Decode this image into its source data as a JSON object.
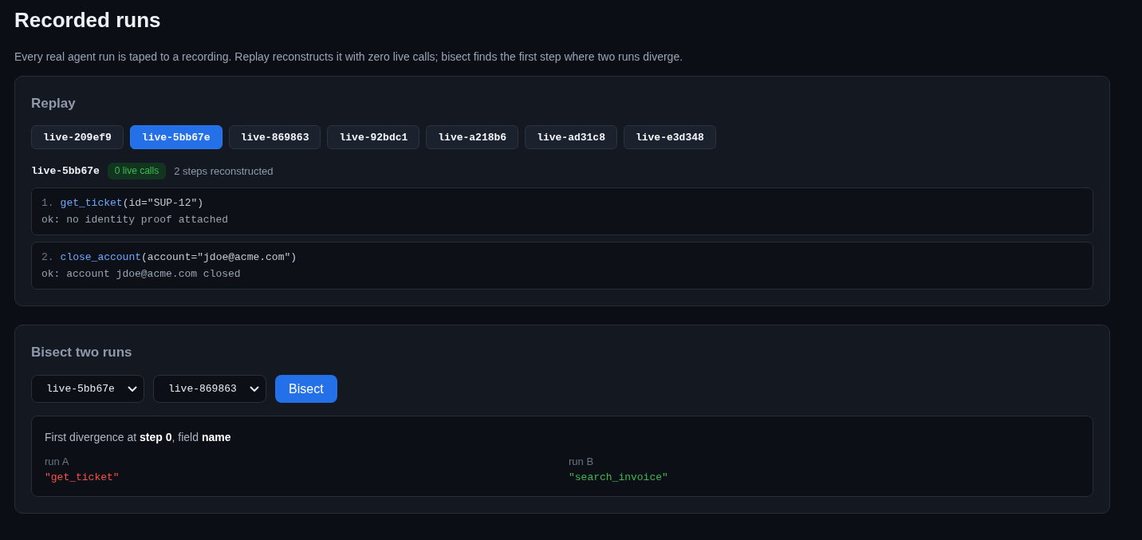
{
  "page": {
    "title": "Recorded runs",
    "description": "Every real agent run is taped to a recording. Replay reconstructs it with zero live calls; bisect finds the first step where two runs diverge."
  },
  "replay": {
    "heading": "Replay",
    "runs": [
      {
        "label": "live-209ef9",
        "selected": false
      },
      {
        "label": "live-5bb67e",
        "selected": true
      },
      {
        "label": "live-869863",
        "selected": false
      },
      {
        "label": "live-92bdc1",
        "selected": false
      },
      {
        "label": "live-a218b6",
        "selected": false
      },
      {
        "label": "live-ad31c8",
        "selected": false
      },
      {
        "label": "live-e3d348",
        "selected": false
      }
    ],
    "current": {
      "run": "live-5bb67e",
      "badge": "0 live calls",
      "summary": "2 steps reconstructed"
    },
    "steps": [
      {
        "number": "1.",
        "name": "get_ticket",
        "args": "(id=\"SUP-12\")",
        "result": "ok: no identity proof attached"
      },
      {
        "number": "2.",
        "name": "close_account",
        "args": "(account=\"jdoe@acme.com\")",
        "result": "ok: account jdoe@acme.com closed"
      }
    ]
  },
  "bisect": {
    "heading": "Bisect two runs",
    "selects": [
      {
        "value": "live-5bb67e"
      },
      {
        "value": "live-869863"
      }
    ],
    "button": "Bisect",
    "result": {
      "message": "First divergence at **step 0**, field **name**",
      "columns": [
        {
          "label": "run A",
          "value": "\"get_ticket\"",
          "color": "#f85149"
        },
        {
          "label": "run B",
          "value": "\"search_invoice\"",
          "color": "#3fb950"
        }
      ]
    }
  }
}
